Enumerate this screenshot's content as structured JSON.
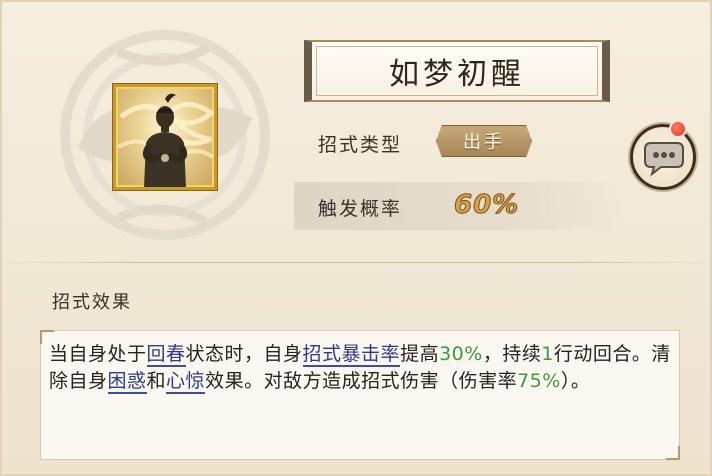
{
  "skill": {
    "name": "如梦初醒",
    "type_label": "招式类型",
    "type_value": "出手",
    "rate_label": "触发概率",
    "rate_value": "60%"
  },
  "effect": {
    "header": "招式效果",
    "segments": [
      {
        "text": "当自身处于",
        "kind": "plain"
      },
      {
        "text": "回春",
        "kind": "keyword"
      },
      {
        "text": "状态时，自身",
        "kind": "plain"
      },
      {
        "text": "招式暴击率",
        "kind": "keyword"
      },
      {
        "text": "提高",
        "kind": "plain"
      },
      {
        "text": "30%",
        "kind": "number"
      },
      {
        "text": "，持续",
        "kind": "plain"
      },
      {
        "text": "1",
        "kind": "number"
      },
      {
        "text": "行动回合。清除自身",
        "kind": "plain"
      },
      {
        "text": "困惑",
        "kind": "keyword"
      },
      {
        "text": "和",
        "kind": "plain"
      },
      {
        "text": "心惊",
        "kind": "keyword"
      },
      {
        "text": "效果。对敌方造成招式伤害（伤害率",
        "kind": "plain"
      },
      {
        "text": "75%",
        "kind": "number"
      },
      {
        "text": "）。",
        "kind": "plain"
      }
    ]
  },
  "icons": {
    "portrait": "martial-artist-portrait",
    "chat": "chat-bubble-icon",
    "notification": "notification-dot"
  },
  "colors": {
    "keyword": "#2b3a8c",
    "number": "#3d9a38",
    "rate": "#d8a24a",
    "portrait_border": "#c89a2a"
  }
}
